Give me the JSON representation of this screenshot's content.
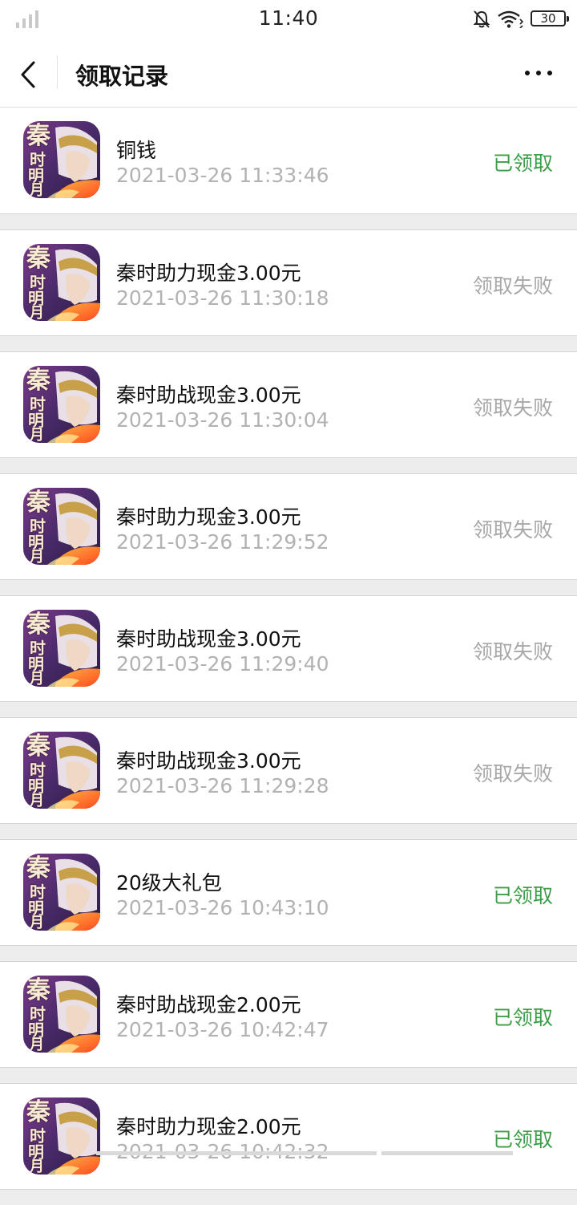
{
  "status_bar": {
    "time": "11:40",
    "battery": "30"
  },
  "header": {
    "title": "领取记录"
  },
  "colors": {
    "received": "#3d9e48",
    "failed": "#a8a8a8"
  },
  "records": [
    {
      "title": "铜钱",
      "time": "2021-03-26 11:33:46",
      "status": "已领取",
      "state": "received"
    },
    {
      "title": "秦时助力现金3.00元",
      "time": "2021-03-26 11:30:18",
      "status": "领取失败",
      "state": "failed"
    },
    {
      "title": "秦时助战现金3.00元",
      "time": "2021-03-26 11:30:04",
      "status": "领取失败",
      "state": "failed"
    },
    {
      "title": "秦时助力现金3.00元",
      "time": "2021-03-26 11:29:52",
      "status": "领取失败",
      "state": "failed"
    },
    {
      "title": "秦时助战现金3.00元",
      "time": "2021-03-26 11:29:40",
      "status": "领取失败",
      "state": "failed"
    },
    {
      "title": "秦时助战现金3.00元",
      "time": "2021-03-26 11:29:28",
      "status": "领取失败",
      "state": "failed"
    },
    {
      "title": "20级大礼包",
      "time": "2021-03-26 10:43:10",
      "status": "已领取",
      "state": "received"
    },
    {
      "title": "秦时助战现金2.00元",
      "time": "2021-03-26 10:42:47",
      "status": "已领取",
      "state": "received"
    },
    {
      "title": "秦时助力现金2.00元",
      "time": "2021-03-26 10:42:32",
      "status": "已领取",
      "state": "received"
    }
  ],
  "icons": {
    "back": "chevron-left-icon",
    "more": "more-dots-icon",
    "signal": "signal-icon",
    "mute": "bell-off-icon",
    "wifi": "wifi-icon",
    "battery": "battery-icon",
    "app": "qinshi-mingyue-app-icon"
  },
  "app_icon_glyphs": [
    "秦",
    "时",
    "明",
    "月"
  ]
}
